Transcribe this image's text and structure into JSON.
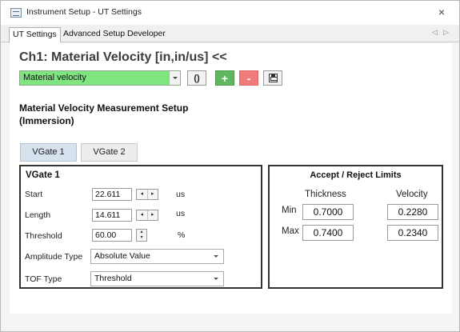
{
  "window": {
    "title": "Instrument Setup - UT Settings",
    "close_glyph": "×"
  },
  "tabs": [
    {
      "label": "UT Settings",
      "active": true
    },
    {
      "label": "Advanced Setup",
      "active": false
    },
    {
      "label": "Developer",
      "active": false
    }
  ],
  "tab_nav": {
    "prev": "◁",
    "next": "▷"
  },
  "page": {
    "title": "Ch1: Material Velocity [in,in/us] <<"
  },
  "measurement_select": {
    "value": "Material velocity",
    "color": "#7fe57f"
  },
  "toolbar": {
    "reset_icon": "refresh-icon",
    "reset_glyph": "()",
    "add_glyph": "+",
    "remove_glyph": "-",
    "save_icon": "save-icon"
  },
  "section": {
    "heading_line1": "Material Velocity Measurement Setup",
    "heading_line2": "(Immersion)"
  },
  "vgate_tabs": [
    {
      "label": "VGate 1",
      "active": true
    },
    {
      "label": "VGate 2",
      "active": false
    }
  ],
  "vgate": {
    "title": "VGate 1",
    "start": {
      "label": "Start",
      "value": "22.611",
      "unit": "us"
    },
    "length": {
      "label": "Length",
      "value": "14.611",
      "unit": "us"
    },
    "threshold": {
      "label": "Threshold",
      "value": "60.00",
      "unit": "%"
    },
    "amplitude_type": {
      "label": "Amplitude Type",
      "value": "Absolute Value"
    },
    "tof_type": {
      "label": "TOF Type",
      "value": "Threshold"
    }
  },
  "limits": {
    "title": "Accept / Reject Limits",
    "col_thickness": "Thickness",
    "col_velocity": "Velocity",
    "min": {
      "label": "Min",
      "thickness": "0.7000",
      "velocity": "0.2280"
    },
    "max": {
      "label": "Max",
      "thickness": "0.7400",
      "velocity": "0.2340"
    }
  }
}
